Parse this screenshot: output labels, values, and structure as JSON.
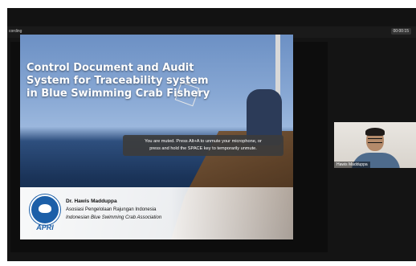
{
  "window": {
    "recording_label": "cording",
    "timer": "00:00:15"
  },
  "slide": {
    "title": "Control Document and Audit System for Traceability system in Blue Swimming Crab Fishery",
    "presenter": "Dr. Hawis Madduppa",
    "organization": "Asosiasi Pengelolaan Rajungan Indonesia",
    "organization_en": "Indonesian Blue Swimming Crab Association",
    "logo_text": "APRI"
  },
  "notification": {
    "line1": "You are muted. Press Alt+A to unmute your microphone, or",
    "line2": "press and hold the SPACE key to temporarily unmute."
  },
  "participant": {
    "name": "Hawis Madduppa"
  },
  "colors": {
    "app_background": "#141414",
    "logo_blue": "#1c5fa8",
    "toast_background": "#3c3c3c"
  }
}
